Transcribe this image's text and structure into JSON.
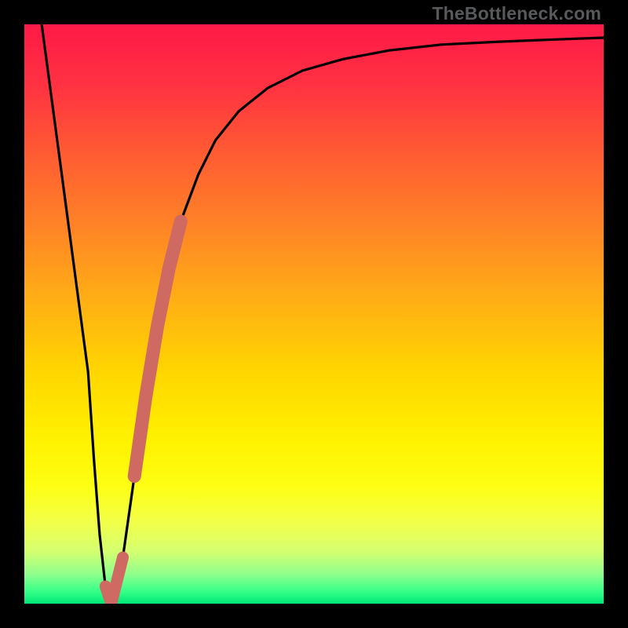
{
  "watermark": "TheBottleneck.com",
  "chart_data": {
    "type": "line",
    "title": "",
    "xlabel": "",
    "ylabel": "",
    "xlim": [
      0,
      100
    ],
    "ylim": [
      0,
      100
    ],
    "grid": false,
    "legend": false,
    "background": "vertical-gradient red→yellow→green",
    "series": [
      {
        "name": "bottleneck-curve",
        "color": "#000000",
        "x": [
          3,
          5,
          7,
          9,
          11,
          12,
          13,
          14,
          15,
          17,
          19,
          21,
          23,
          25,
          27,
          30,
          33,
          37,
          42,
          48,
          55,
          63,
          72,
          82,
          92,
          100
        ],
        "y": [
          100,
          85,
          70,
          55,
          40,
          25,
          12,
          3,
          0,
          8,
          22,
          36,
          48,
          58,
          66,
          74,
          80,
          85,
          89,
          92,
          94,
          95.5,
          96.5,
          97,
          97.4,
          97.7
        ]
      },
      {
        "name": "highlight-segment",
        "color": "#cf6a62",
        "x": [
          14,
          15,
          17,
          19,
          21,
          23,
          25,
          27
        ],
        "y": [
          3,
          0,
          8,
          22,
          36,
          48,
          58,
          66
        ],
        "note": "thick salmon overlay near the V-shaped minimum and rising branch"
      }
    ]
  }
}
